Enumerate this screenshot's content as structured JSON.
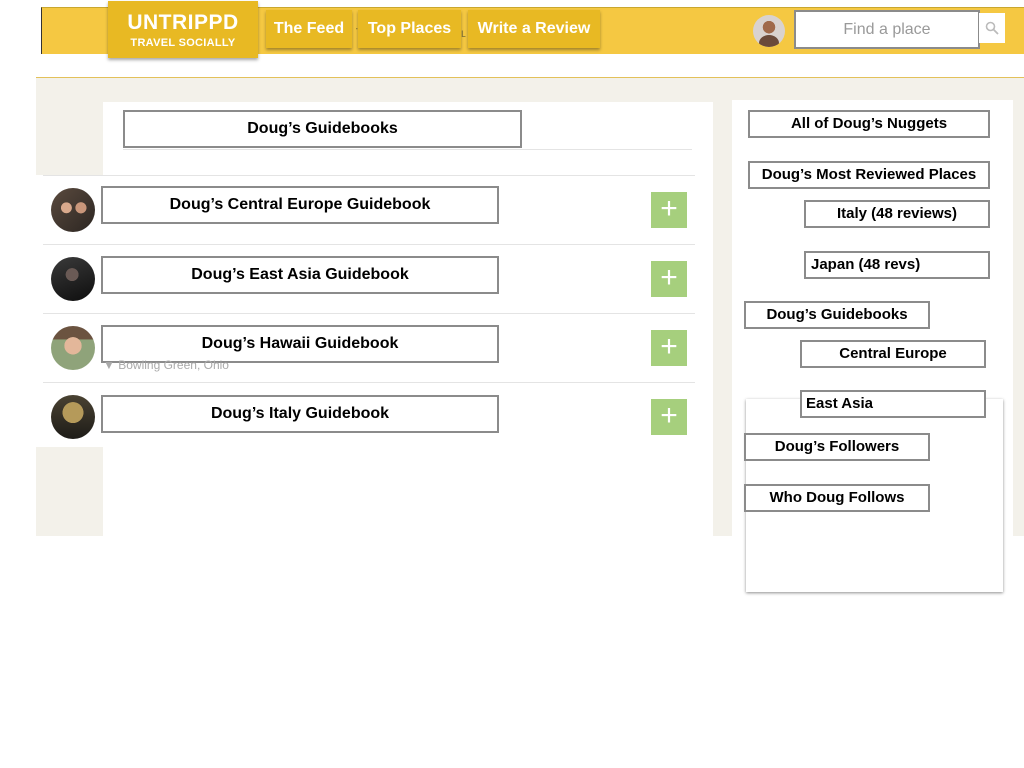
{
  "header": {
    "logo_title": "UNTRIPPD",
    "logo_tagline": "TRAVEL SOCIALLY",
    "nav": [
      "The Feed",
      "Top Places",
      "Write a Review"
    ],
    "search_placeholder": "Find a place",
    "search_icon": "search-icon"
  },
  "main": {
    "title": "Doug’s Guidebooks",
    "guidebooks": [
      {
        "label": "Doug’s Central Europe Guidebook",
        "avatar": "couple-photo"
      },
      {
        "label": "Doug’s East Asia Guidebook",
        "avatar": "dark-portrait-photo"
      },
      {
        "label": "Doug’s Hawaii Guidebook",
        "avatar": "smiling-man-photo",
        "location": "Bowling Green, Ohio"
      },
      {
        "label": "Doug’s Italy Guidebook",
        "avatar": "night-lights-photo"
      }
    ],
    "add_icon": "plus-icon"
  },
  "sidebar": {
    "all_nuggets": "All of Doug’s Nuggets",
    "most_reviewed": "Doug’s Most Reviewed Places",
    "reviewed_places": [
      "Italy (48 reviews)",
      "Japan (48 revs)"
    ],
    "guidebooks_heading": "Doug’s Guidebooks",
    "guidebook_links": [
      "Central Europe",
      "East Asia"
    ],
    "followers": "Doug’s Followers",
    "follows": "Who Doug Follows"
  },
  "colors": {
    "header_bg": "#f5c842",
    "button_bg": "#e8b923",
    "add_button": "#a6cf7d",
    "page_bg": "#f3f1ea"
  }
}
